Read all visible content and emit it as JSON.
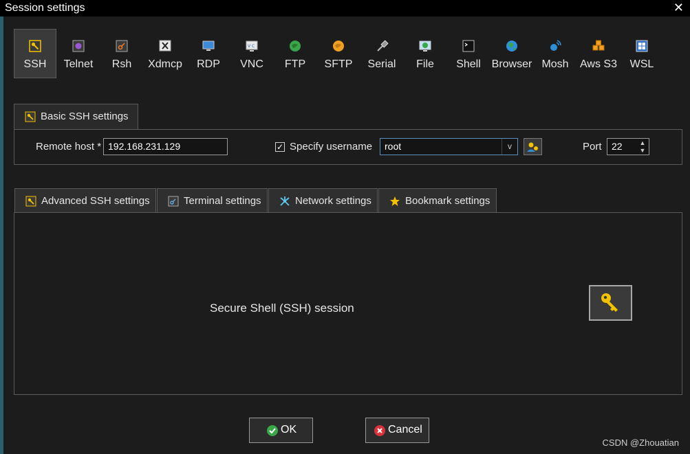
{
  "window": {
    "title": "Session settings",
    "close_icon": "close-icon"
  },
  "protocols": [
    {
      "label": "SSH",
      "icon": "key-icon",
      "selected": true
    },
    {
      "label": "Telnet",
      "icon": "telnet-icon"
    },
    {
      "label": "Rsh",
      "icon": "rsh-icon"
    },
    {
      "label": "Xdmcp",
      "icon": "xdmcp-icon"
    },
    {
      "label": "RDP",
      "icon": "rdp-icon"
    },
    {
      "label": "VNC",
      "icon": "vnc-icon"
    },
    {
      "label": "FTP",
      "icon": "ftp-icon"
    },
    {
      "label": "SFTP",
      "icon": "sftp-icon"
    },
    {
      "label": "Serial",
      "icon": "serial-icon"
    },
    {
      "label": "File",
      "icon": "file-icon"
    },
    {
      "label": "Shell",
      "icon": "shell-icon"
    },
    {
      "label": "Browser",
      "icon": "browser-icon"
    },
    {
      "label": "Mosh",
      "icon": "mosh-icon"
    },
    {
      "label": "Aws S3",
      "icon": "aws-s3-icon"
    },
    {
      "label": "WSL",
      "icon": "wsl-icon"
    }
  ],
  "basic": {
    "tab_label": "Basic SSH settings",
    "remote_host_label": "Remote host *",
    "remote_host_value": "192.168.231.129",
    "specify_username_label": "Specify username",
    "specify_username_checked": true,
    "username_value": "root",
    "port_label": "Port",
    "port_value": "22"
  },
  "tabs": [
    {
      "label": "Advanced SSH settings",
      "icon": "key-icon"
    },
    {
      "label": "Terminal settings",
      "icon": "terminal-icon"
    },
    {
      "label": "Network settings",
      "icon": "network-icon"
    },
    {
      "label": "Bookmark settings",
      "icon": "star-icon"
    }
  ],
  "session_description": "Secure Shell (SSH) session",
  "buttons": {
    "ok": "OK",
    "cancel": "Cancel"
  },
  "watermark": "CSDN @Zhouatian",
  "colors": {
    "background": "#1c1c1c",
    "titlebar": "#000000",
    "key_yellow": "#f2c200",
    "ok_green": "#3aa64a",
    "cancel_red": "#d9323a"
  }
}
